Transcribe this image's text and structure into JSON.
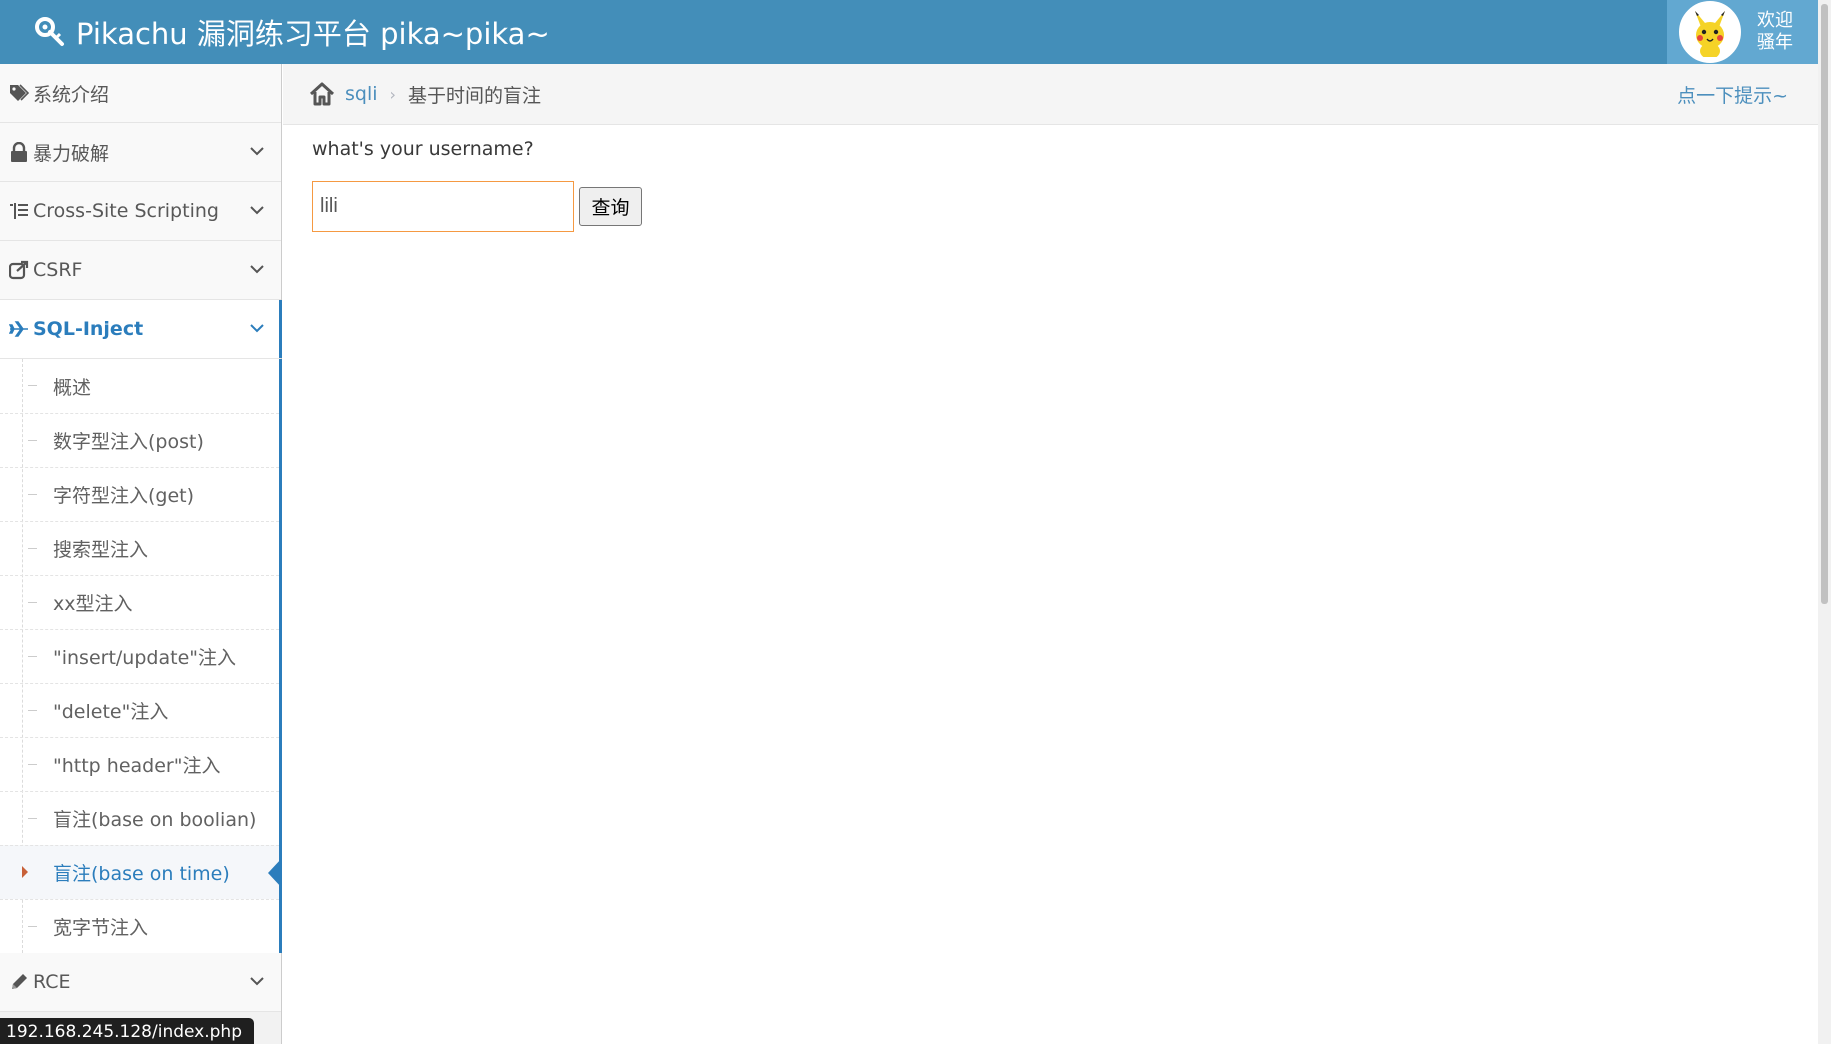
{
  "header": {
    "brand": "Pikachu 漏洞练习平台 pika~pika~",
    "greeting_line1": "欢迎",
    "greeting_line2": "骚年"
  },
  "sidebar": {
    "items": [
      {
        "label": "系统介绍",
        "icon": "tags-icon"
      },
      {
        "label": "暴力破解",
        "icon": "lock-icon"
      },
      {
        "label": "Cross-Site Scripting",
        "icon": "list-icon"
      },
      {
        "label": "CSRF",
        "icon": "share-icon"
      },
      {
        "label": "SQL-Inject",
        "icon": "plane-icon",
        "active": true
      },
      {
        "label": "RCE",
        "icon": "pencil-icon"
      }
    ],
    "sql_submenu": [
      "概述",
      "数字型注入(post)",
      "字符型注入(get)",
      "搜索型注入",
      "xx型注入",
      "\"insert/update\"注入",
      "\"delete\"注入",
      "\"http header\"注入",
      "盲注(base on boolian)",
      "盲注(base on time)",
      "宽字节注入"
    ],
    "active_submenu_index": 9
  },
  "breadcrumb": {
    "link": "sqli",
    "current": "基于时间的盲注",
    "hint": "点一下提示~"
  },
  "form": {
    "prompt": "what's your username?",
    "input_value": "lili",
    "submit_label": "查询"
  },
  "status_bar": {
    "url": "192.168.245.128/index.php"
  },
  "colors": {
    "navbar": "#438eb9",
    "accent": "#2b7dbc",
    "input_focus_border": "#f59942"
  }
}
